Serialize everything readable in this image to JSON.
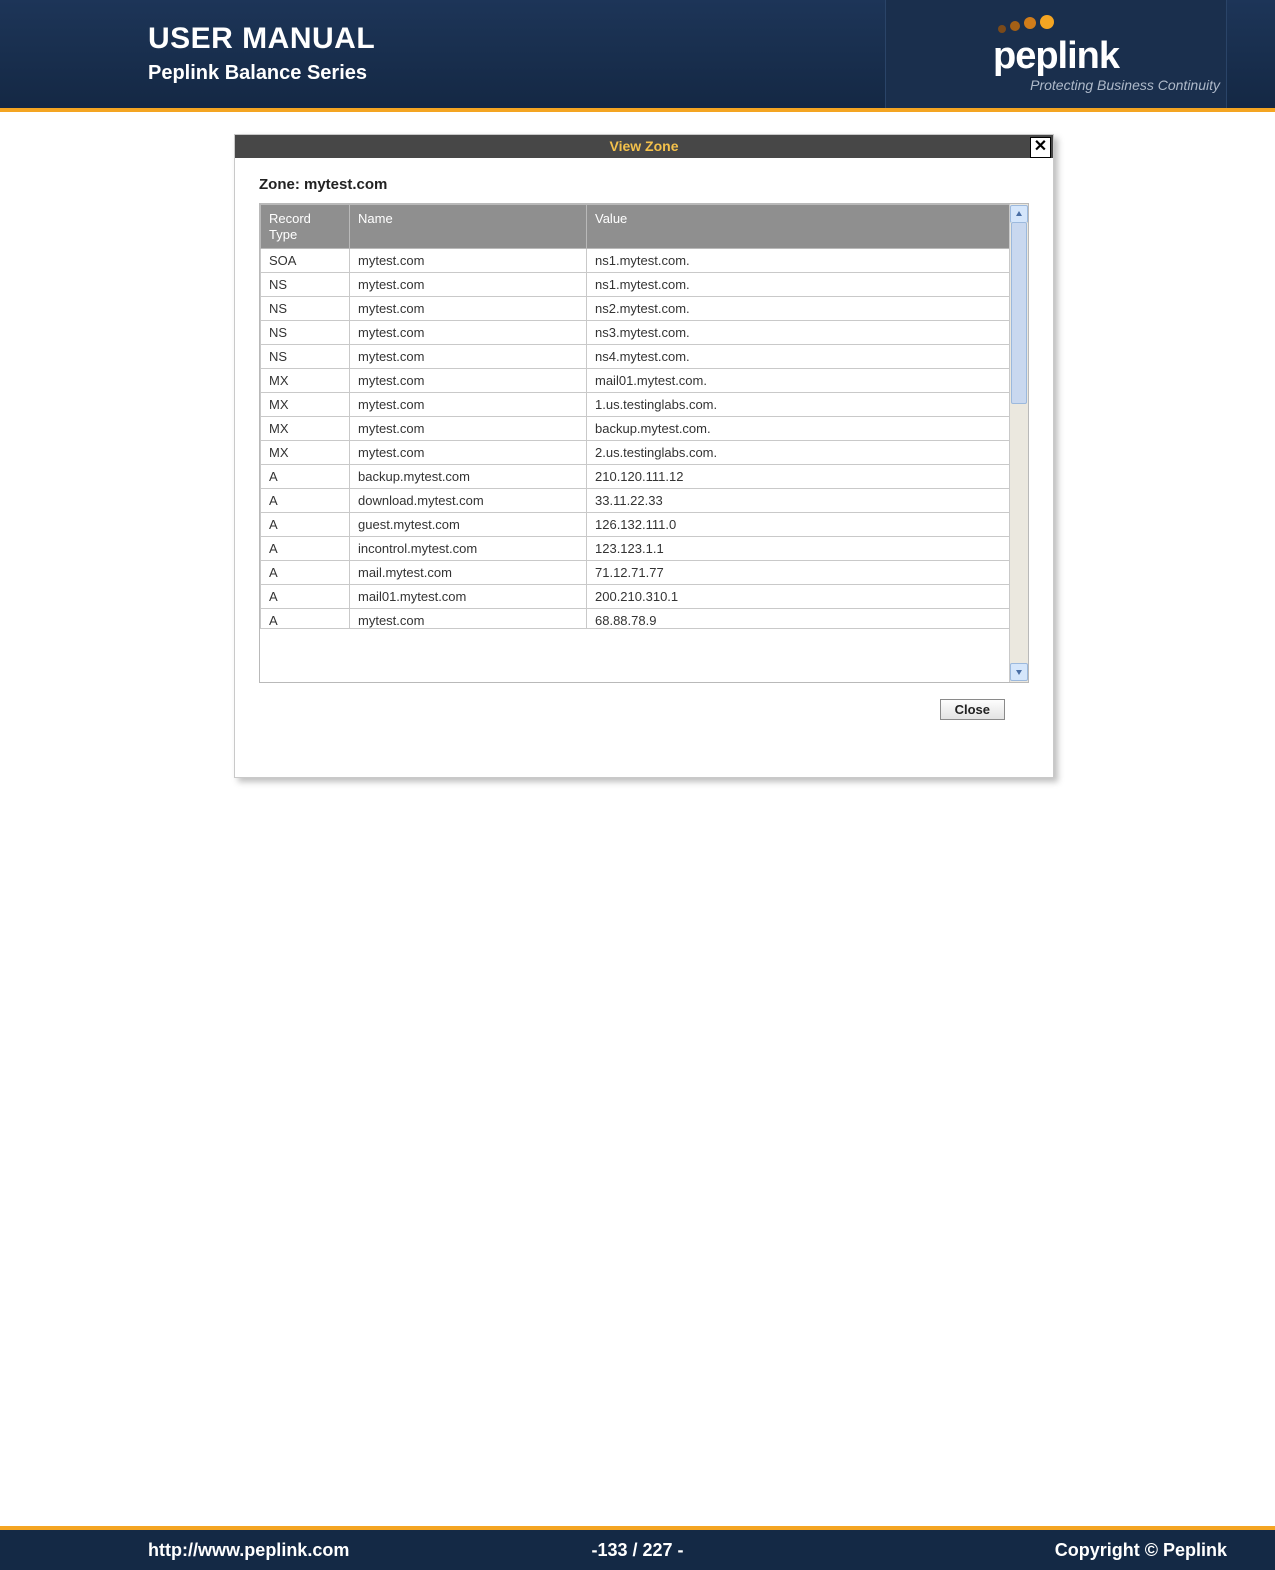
{
  "header": {
    "title": "USER MANUAL",
    "subtitle": "Peplink Balance Series",
    "logo_text": "peplink",
    "logo_tagline": "Protecting Business Continuity"
  },
  "dialog": {
    "title": "View Zone",
    "zone_label": "Zone: mytest.com",
    "close_button": "Close",
    "columns": {
      "c1": "Record\nType",
      "c2": "Name",
      "c3": "Value"
    },
    "rows": [
      {
        "type": "SOA",
        "name": "mytest.com",
        "value": "ns1.mytest.com."
      },
      {
        "type": "NS",
        "name": "mytest.com",
        "value": "ns1.mytest.com."
      },
      {
        "type": "NS",
        "name": "mytest.com",
        "value": "ns2.mytest.com."
      },
      {
        "type": "NS",
        "name": "mytest.com",
        "value": "ns3.mytest.com."
      },
      {
        "type": "NS",
        "name": "mytest.com",
        "value": "ns4.mytest.com."
      },
      {
        "type": "MX",
        "name": "mytest.com",
        "value": "mail01.mytest.com."
      },
      {
        "type": "MX",
        "name": "mytest.com",
        "value": "1.us.testinglabs.com."
      },
      {
        "type": "MX",
        "name": "mytest.com",
        "value": "backup.mytest.com."
      },
      {
        "type": "MX",
        "name": "mytest.com",
        "value": "2.us.testinglabs.com."
      },
      {
        "type": "A",
        "name": "backup.mytest.com",
        "value": "210.120.111.12"
      },
      {
        "type": "A",
        "name": "download.mytest.com",
        "value": "33.11.22.33"
      },
      {
        "type": "A",
        "name": "guest.mytest.com",
        "value": "126.132.111.0"
      },
      {
        "type": "A",
        "name": "incontrol.mytest.com",
        "value": "123.123.1.1"
      },
      {
        "type": "A",
        "name": "mail.mytest.com",
        "value": "71.12.71.77"
      },
      {
        "type": "A",
        "name": "mail01.mytest.com",
        "value": "200.210.310.1"
      },
      {
        "type": "A",
        "name": "mytest.com",
        "value": "68.88.78.9"
      }
    ]
  },
  "footer": {
    "url": "http://www.peplink.com",
    "page": "-133 / 227 -",
    "copyright": "Copyright ©  Peplink"
  }
}
